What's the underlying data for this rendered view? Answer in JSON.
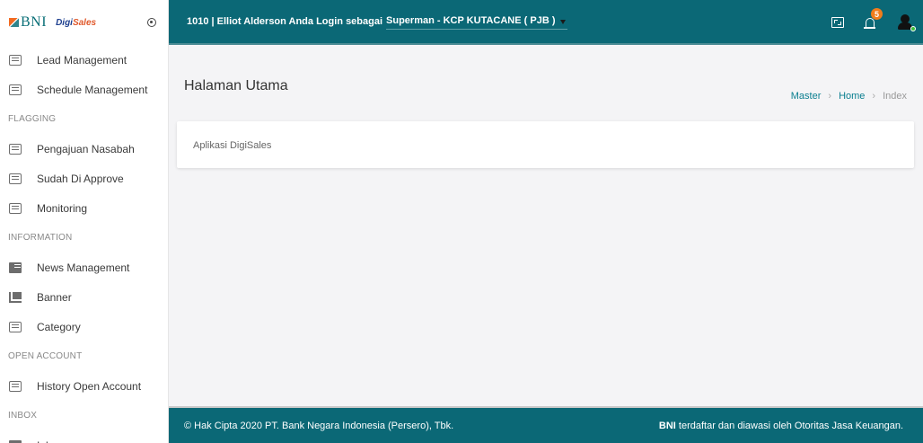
{
  "brand": {
    "bni": "BNI",
    "digisales_prefix": "Digi",
    "digisales_suffix": "Sales"
  },
  "sidebar": {
    "items": [
      {
        "type": "item",
        "label": "Lead Management",
        "icon": "doc-icon"
      },
      {
        "type": "item",
        "label": "Schedule Management",
        "icon": "doc-icon"
      },
      {
        "type": "section",
        "label": "FLAGGING"
      },
      {
        "type": "item",
        "label": "Pengajuan Nasabah",
        "icon": "doc-icon"
      },
      {
        "type": "item",
        "label": "Sudah Di Approve",
        "icon": "doc-icon"
      },
      {
        "type": "item",
        "label": "Monitoring",
        "icon": "doc-icon"
      },
      {
        "type": "section",
        "label": "INFORMATION"
      },
      {
        "type": "item",
        "label": "News Management",
        "icon": "news-icon"
      },
      {
        "type": "item",
        "label": "Banner",
        "icon": "banner-icon"
      },
      {
        "type": "item",
        "label": "Category",
        "icon": "doc-icon"
      },
      {
        "type": "section",
        "label": "OPEN ACCOUNT"
      },
      {
        "type": "item",
        "label": "History Open Account",
        "icon": "doc-icon"
      },
      {
        "type": "section",
        "label": "INBOX"
      },
      {
        "type": "item",
        "label": "Inbox",
        "icon": "inbox-icon"
      }
    ]
  },
  "header": {
    "user_text": "1010 | Elliot Alderson Anda Login sebagai",
    "role_value": "Superman - KCP KUTACANE ( PJB )",
    "notification_count": "5"
  },
  "page": {
    "title": "Halaman Utama",
    "breadcrumb": [
      "Master",
      "Home",
      "Index"
    ],
    "card_text": "Aplikasi DigiSales"
  },
  "footer": {
    "copyright": "© Hak Cipta 2020 PT. Bank Negara Indonesia (Persero), Tbk.",
    "notice_bold": "BNI",
    "notice_rest": " terdaftar dan diawasi oleh Otoritas Jasa Keuangan."
  },
  "colors": {
    "primary": "#0b6876",
    "badge": "#f07c1b",
    "link": "#0b7f90"
  }
}
